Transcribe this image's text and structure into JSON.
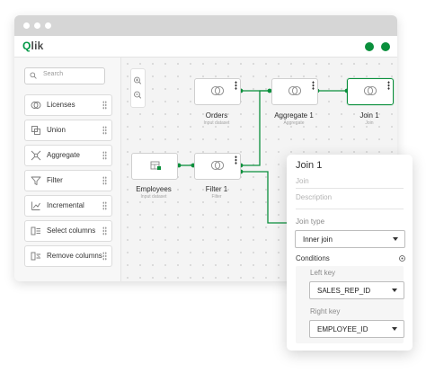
{
  "app": {
    "logo_text": "Qlik"
  },
  "sidebar": {
    "search": {
      "placeholder": "Search"
    },
    "tools": [
      {
        "label": "Licenses",
        "icon": "licenses-icon"
      },
      {
        "label": "Union",
        "icon": "union-icon"
      },
      {
        "label": "Aggregate",
        "icon": "aggregate-icon"
      },
      {
        "label": "Filter",
        "icon": "filter-icon"
      },
      {
        "label": "Incremental",
        "icon": "incremental-icon"
      },
      {
        "label": "Select columns",
        "icon": "select-columns-icon"
      },
      {
        "label": "Remove columns",
        "icon": "remove-columns-icon"
      }
    ]
  },
  "canvas": {
    "nodes": [
      {
        "id": "orders",
        "title": "Orders",
        "subtitle": "Input dataset"
      },
      {
        "id": "aggregate1",
        "title": "Aggregate 1",
        "subtitle": "Aggregate"
      },
      {
        "id": "join1",
        "title": "Join 1",
        "subtitle": "Join"
      },
      {
        "id": "employees",
        "title": "Employees",
        "subtitle": "Input dataset"
      },
      {
        "id": "filter1",
        "title": "Filter 1",
        "subtitle": "Filter"
      }
    ]
  },
  "panel": {
    "title": "Join 1",
    "name_placeholder": "Join",
    "description_placeholder": "Description",
    "join_type_label": "Join type",
    "join_type_value": "Inner join",
    "conditions_label": "Conditions",
    "left_key_label": "Left key",
    "left_key_value": "SALES_REP_ID",
    "right_key_label": "Right key",
    "right_key_value": "EMPLOYEE_ID"
  },
  "colors": {
    "accent": "#0a8f3c",
    "chrome": "#d6d6d6",
    "canvas": "#f4f4f4"
  }
}
